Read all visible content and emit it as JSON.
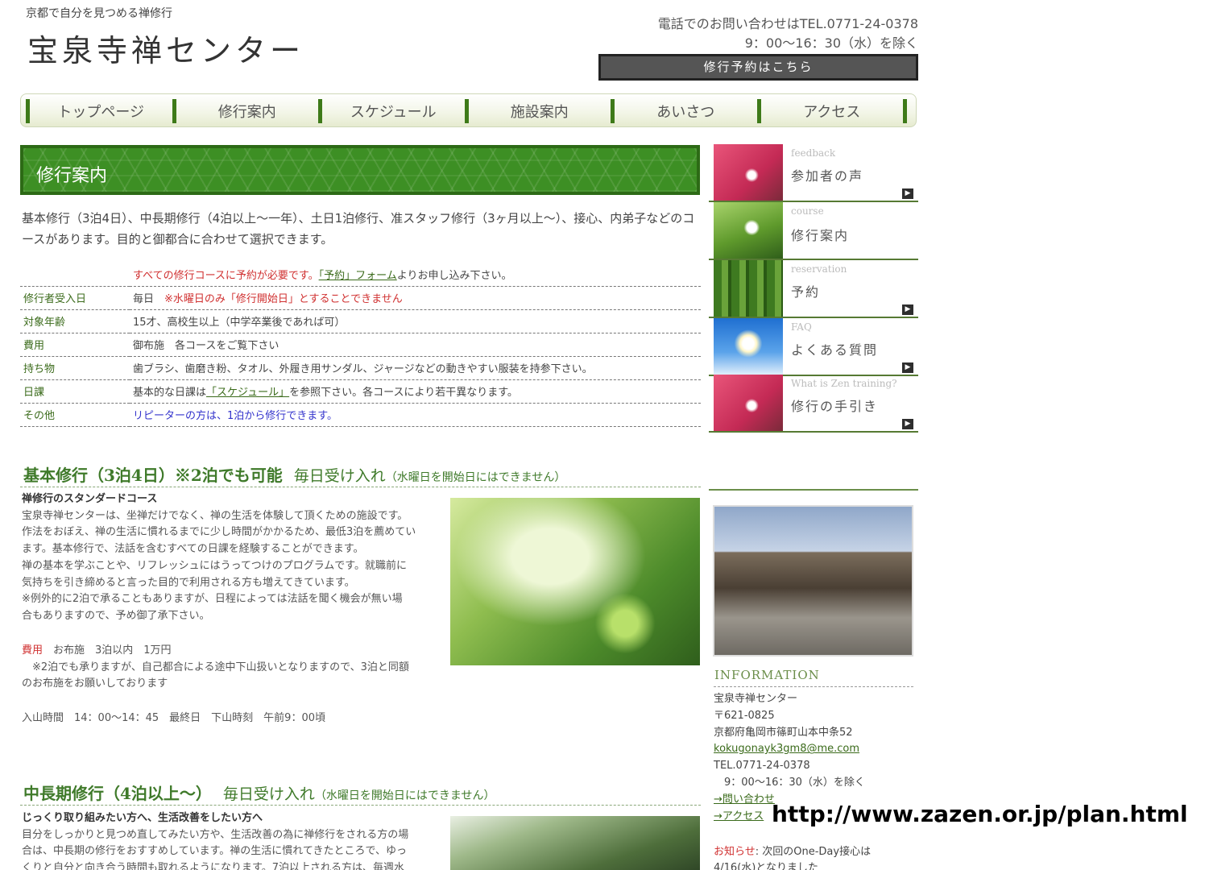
{
  "header": {
    "tagline": "京都で自分を見つめる禅修行",
    "site_title": "宝泉寺禅センター",
    "contact_tel": "電話でのお問い合わせはTEL.0771-24-0378",
    "contact_hours": "9：00〜16：30（水）を除く",
    "reserve_button": "修行予約はこちら"
  },
  "nav": {
    "items": [
      "トップページ",
      "修行案内",
      "スケジュール",
      "施設案内",
      "あいさつ",
      "アクセス"
    ]
  },
  "main": {
    "banner_title": "修行案内",
    "intro": "基本修行（3泊4日）、中長期修行（4泊以上〜一年）、土日1泊修行、准スタッフ修行（3ヶ月以上〜）、接心、内弟子などのコースがあります。目的と御都合に合わせて選択できます。",
    "notice_pre": "すべての修行コースに予約が必要です。",
    "notice_link": "「予約」フォーム",
    "notice_post": "よりお申し込み下さい。",
    "table": [
      {
        "key": "修行者受入日",
        "value": "毎日　",
        "note": "※水曜日のみ「修行開始日」とすることできません"
      },
      {
        "key": "対象年齢",
        "value": "15才、高校生以上（中学卒業後であれば可）"
      },
      {
        "key": "費用",
        "value": "御布施　各コースをご覧下さい"
      },
      {
        "key": "持ち物",
        "value": "歯ブラシ、歯磨き粉、タオル、外履き用サンダル、ジャージなどの動きやすい服装を持参下さい。"
      },
      {
        "key": "日課",
        "value_pre": "基本的な日課は",
        "value_link": "「スケジュール」",
        "value_post": "を参照下さい。各コースにより若干異なります。"
      },
      {
        "key": "その他",
        "value": "リピーターの方は、1泊から修行できます。"
      }
    ],
    "section1": {
      "heading": "基本修行（3泊4日）※2泊でも可能",
      "sub": "毎日受け入れ",
      "note": "（水曜日を開始日にはできません）",
      "lead": "禅修行のスタンダードコース",
      "body": [
        "宝泉寺禅センターは、坐禅だけでなく、禅の生活を体験して頂くための施設です。",
        "作法をおぼえ、禅の生活に慣れるまでに少し時間がかかるため、最低3泊を薦めてい",
        "ます。基本修行で、法話を含むすべての日課を経験することができます。",
        "禅の基本を学ぶことや、リフレッシュにはうってつけのプログラムです。就職前に",
        "気持ちを引き締めると言った目的で利用される方も増えてきています。",
        "※例外的に2泊で承ることもありますが、日程によっては法話を聞く機会が無い場",
        "合もありますので、予め御了承下さい。"
      ],
      "fee_label": "費用",
      "fee_value": "　お布施　3泊以内　1万円",
      "fee_note1": "　※2泊でも承りますが、自己都合による途中下山扱いとなりますので、3泊と同額",
      "fee_note2": "のお布施をお願いしております",
      "times": "入山時間　14：00〜14：45　最終日　下山時刻　午前9：00頃"
    },
    "section2": {
      "heading": "中長期修行（4泊以上〜）",
      "sub": "毎日受け入れ",
      "note": "（水曜日を開始日にはできません）",
      "lead": "じっくり取り組みたい方へ、生活改善をしたい方へ",
      "body": [
        "目分をしっかりと見つめ直してみたい方や、生活改善の為に禅修行をされる方の場",
        "合は、中長期の修行をおすすめしています。禅の生活に慣れてきたところで、ゆっ",
        "くりと自分と向き合う時間も取れるようになります。7泊以上される方は、毎週水"
      ]
    }
  },
  "sidebar": {
    "items": [
      {
        "en": "feedback",
        "jp": "参加者の声",
        "thumb": "flower-thumb"
      },
      {
        "en": "course",
        "jp": "修行案内",
        "thumb": "leaf-thumb"
      },
      {
        "en": "reservation",
        "jp": "予約",
        "thumb": "bamboo-thumb"
      },
      {
        "en": "FAQ",
        "jp": "よくある質問",
        "thumb": "sky-thumb"
      },
      {
        "en": "What is Zen training?",
        "jp": "修行の手引き",
        "thumb": "flower-thumb"
      }
    ],
    "info_title": "INFORMATION",
    "info_lines": {
      "name": "宝泉寺禅センター",
      "zip": "〒621-0825",
      "address": "京都府亀岡市篠町山本中条52",
      "email": "kokugonayk3gm8@me.com",
      "tel": "TEL.0771-24-0378",
      "hours": "　9：00〜16：30（水）を除く",
      "contact_link": "→問い合わせ",
      "access_link": "→アクセス"
    },
    "news_label": "お知らせ",
    "news_text": ": 次回のOne-Day接心は",
    "news_text2": "4/16(水)となりました"
  },
  "overlay": {
    "url": "http://www.zazen.or.jp/plan.html"
  },
  "colors": {
    "brand_green": "#3d8f24",
    "nav_bar": "#3e7a19",
    "accent_red": "#d03030",
    "link_blue": "#3333cc"
  }
}
